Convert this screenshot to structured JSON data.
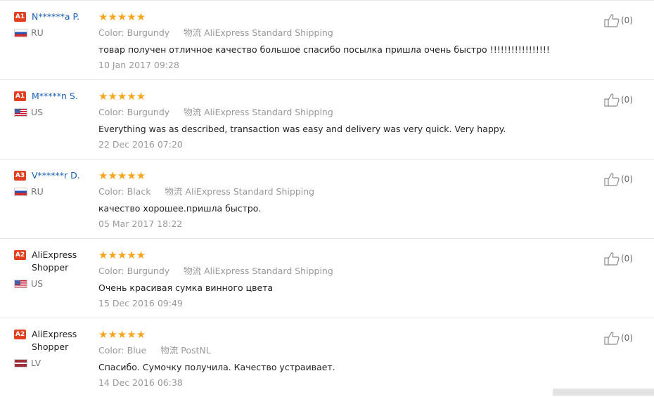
{
  "reviews": [
    {
      "badge": "A1",
      "name": "N******a P.",
      "name_is_link": true,
      "country": "RU",
      "flag": "ru",
      "stars": "★★★★★",
      "color_label": "Color:",
      "color_value": "Burgundy",
      "shipping_label": "物流",
      "shipping_value": "AliExpress Standard Shipping",
      "text": "товар получен отличное качество большое спасибо посылка пришла очень быстро !!!!!!!!!!!!!!!!!",
      "date": "10 Jan 2017 09:28",
      "likes": "(0)"
    },
    {
      "badge": "A1",
      "name": "M*****n S.",
      "name_is_link": true,
      "country": "US",
      "flag": "us",
      "stars": "★★★★★",
      "color_label": "Color:",
      "color_value": "Burgundy",
      "shipping_label": "物流",
      "shipping_value": "AliExpress Standard Shipping",
      "text": "Everything was as described, transaction was easy and delivery was very quick. Very happy.",
      "date": "22 Dec 2016 07:20",
      "likes": "(0)"
    },
    {
      "badge": "A3",
      "name": "V******r D.",
      "name_is_link": true,
      "country": "RU",
      "flag": "ru",
      "stars": "★★★★★",
      "color_label": "Color:",
      "color_value": "Black",
      "shipping_label": "物流",
      "shipping_value": "AliExpress Standard Shipping",
      "text": "качество хорошее.пришла быстро.",
      "date": "05 Mar 2017 18:22",
      "likes": "(0)"
    },
    {
      "badge": "A2",
      "name": "AliExpress Shopper",
      "name_is_link": false,
      "country": "US",
      "flag": "us",
      "stars": "★★★★★",
      "color_label": "Color:",
      "color_value": "Burgundy",
      "shipping_label": "物流",
      "shipping_value": "AliExpress Standard Shipping",
      "text": "Очень красивая сумка винного цвета",
      "date": "15 Dec 2016 09:49",
      "likes": "(0)"
    },
    {
      "badge": "A2",
      "name": "AliExpress Shopper",
      "name_is_link": false,
      "country": "LV",
      "flag": "lv",
      "stars": "★★★★★",
      "color_label": "Color:",
      "color_value": "Blue",
      "shipping_label": "物流",
      "shipping_value": "PostNL",
      "text": "Спасибо. Сумочку получила. Качество устраивает.",
      "date": "14 Dec 2016 06:38",
      "likes": "(0)"
    }
  ],
  "colors": {
    "badge": "#e0401f",
    "name_link": "#1a5fb4",
    "stars": "#f7a51c",
    "muted": "#999999"
  },
  "icons": {
    "like": "thumbs-up-icon"
  }
}
